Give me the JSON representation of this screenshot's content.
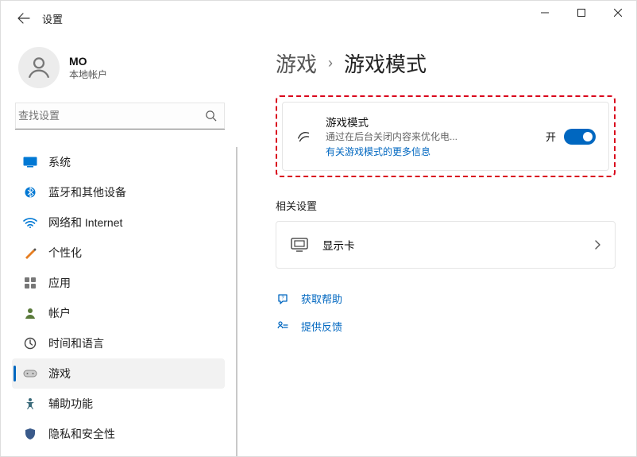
{
  "window": {
    "title": "设置"
  },
  "account": {
    "name": "MO",
    "sub": "本地帐户"
  },
  "search": {
    "placeholder": "查找设置"
  },
  "nav": {
    "system": "系统",
    "bluetooth": "蓝牙和其他设备",
    "network": "网络和 Internet",
    "personalization": "个性化",
    "apps": "应用",
    "accounts": "帐户",
    "time": "时间和语言",
    "gaming": "游戏",
    "accessibility": "辅助功能",
    "privacy": "隐私和安全性"
  },
  "breadcrumb": {
    "parent": "游戏",
    "current": "游戏模式"
  },
  "game_mode": {
    "title": "游戏模式",
    "desc": "通过在后台关闭内容来优化电...",
    "link": "有关游戏模式的更多信息",
    "toggle_label": "开"
  },
  "related": {
    "heading": "相关设置",
    "display": "显示卡"
  },
  "help": {
    "get_help": "获取帮助",
    "feedback": "提供反馈"
  }
}
